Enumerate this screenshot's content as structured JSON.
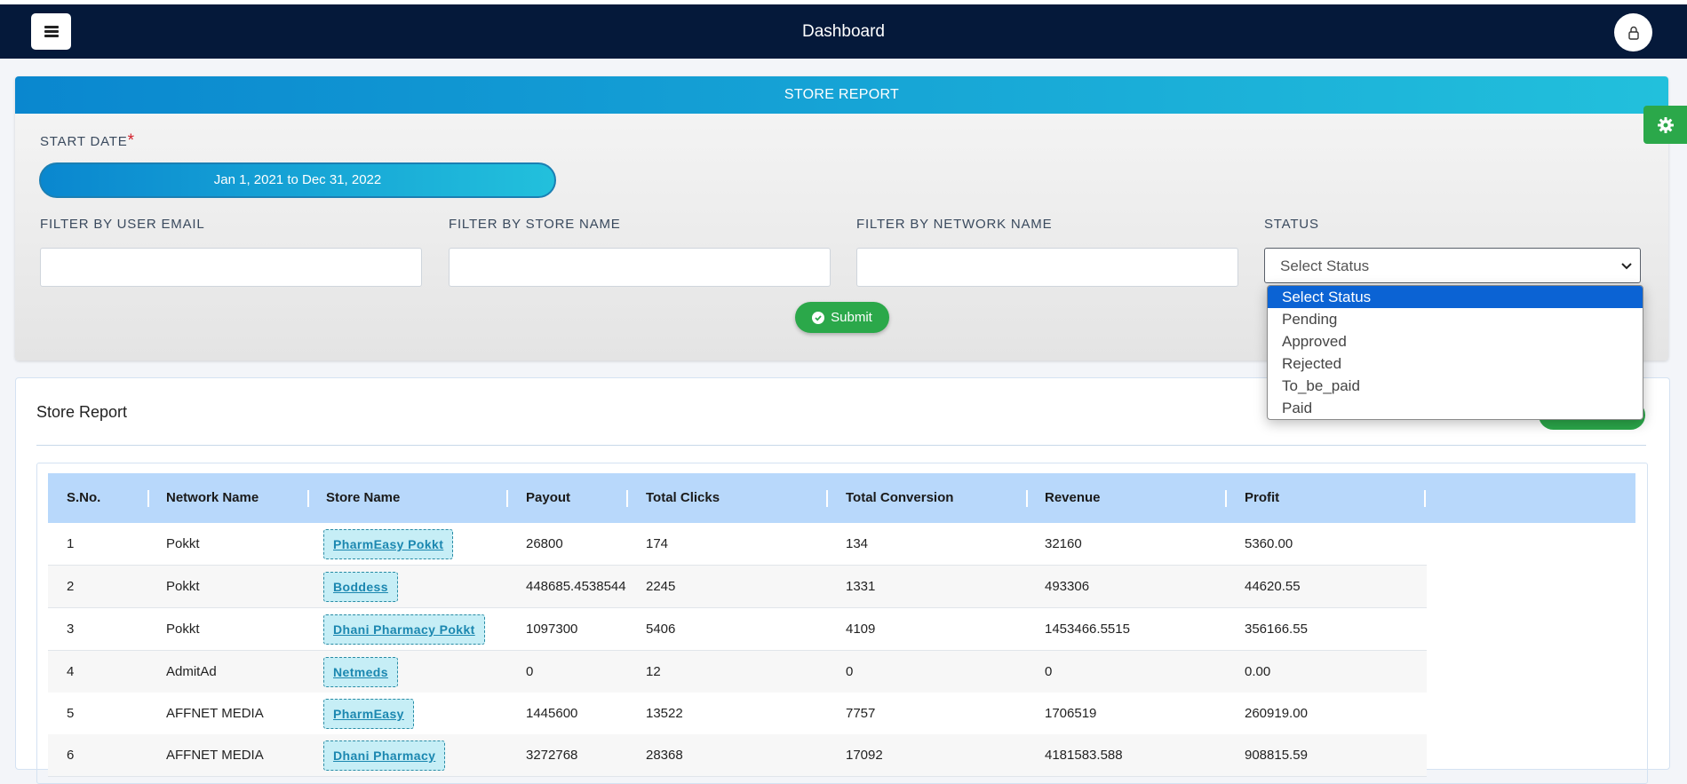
{
  "nav": {
    "title": "Dashboard"
  },
  "filters": {
    "header": "STORE REPORT",
    "start_date_label": "START DATE",
    "required_mark": "*",
    "date_range": "Jan 1, 2021 to Dec 31, 2022",
    "user_email_label": "FILTER BY USER EMAIL",
    "user_email_value": "",
    "store_name_label": "FILTER BY STORE NAME",
    "store_name_value": "",
    "network_name_label": "FILTER BY NETWORK NAME",
    "network_name_value": "",
    "status_label": "STATUS",
    "status_selected": "Select Status",
    "status_options": [
      "Select Status",
      "Pending",
      "Approved",
      "Rejected",
      "To_be_paid",
      "Paid"
    ],
    "submit_label": "Submit"
  },
  "report": {
    "title": "Store Report",
    "columns": [
      "S.No.",
      "Network Name",
      "Store Name",
      "Payout",
      "Total Clicks",
      "Total Conversion",
      "Revenue",
      "Profit"
    ],
    "rows": [
      [
        "1",
        "Pokkt",
        "PharmEasy Pokkt",
        "26800",
        "174",
        "134",
        "32160",
        "5360.00"
      ],
      [
        "2",
        "Pokkt",
        "Boddess",
        "448685.4538544",
        "2245",
        "1331",
        "493306",
        "44620.55"
      ],
      [
        "3",
        "Pokkt",
        "Dhani Pharmacy Pokkt",
        "1097300",
        "5406",
        "4109",
        "1453466.5515",
        "356166.55"
      ],
      [
        "4",
        "AdmitAd",
        "Netmeds",
        "0",
        "12",
        "0",
        "0",
        "0.00"
      ],
      [
        "5",
        "AFFNET MEDIA",
        "PharmEasy",
        "1445600",
        "13522",
        "7757",
        "1706519",
        "260919.00"
      ],
      [
        "6",
        "AFFNET MEDIA",
        "Dhani Pharmacy",
        "3272768",
        "28368",
        "17092",
        "4181583.588",
        "908815.59"
      ]
    ]
  },
  "icons": {
    "menu": "hamburger-icon",
    "user": "user-lock-icon",
    "gear": "gear-icon",
    "submit": "check-circle-icon",
    "select": "chevron-down-icon"
  },
  "colors": {
    "nav_bg": "#05193a",
    "accent_start": "#0a87cf",
    "accent_end": "#22c0dc",
    "success": "#2ba84a",
    "table_header": "#b8d8fb",
    "dropdown_selected": "#0b63d4"
  }
}
